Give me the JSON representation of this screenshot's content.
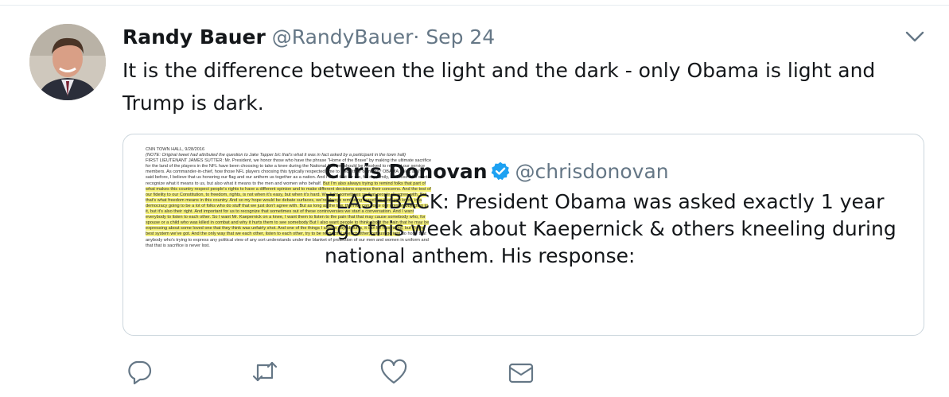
{
  "tweet": {
    "author_name": "Randy Bauer",
    "author_handle": "@RandyBauer",
    "separator": "·",
    "date": "Sep 24",
    "text": "It is the difference between the light and the dark - only Obama is light and Trump is dark."
  },
  "quoted": {
    "author_name": "Chris Donovan",
    "author_handle": "@chrisdonovan",
    "text": "FLASHBACK: President Obama was asked exactly 1 year ago this week about Kaepernick & others kneeling during national anthem. His response:",
    "image_text": {
      "header": "CNN TOWN HALL, 9/28/2016",
      "note": "(NOTE: Original tweet had attributed the question to Jake Tapper b/c that's what it was in fact asked by a participant in the town hall)",
      "plain": "FIRST LIEUTENANT JAMES SUTTER: Mr. President, we honor those who have the phrase \"Home of the Brave\" by making the ultimate sacrifice for the land of the players in the NFL have been choosing to take a knee during the National Anthem should be resolved to respect our service members. As commander-in-chief, how those NFL players choosing this typically respected time to voice their opinions? OBAMA: Well, as I've said before, I believe that us honoring our flag and our anthem us together as a nation. And I think that for me, for my family, for those who want recognize what it means to us, but also what it means to the men and women who behalf.",
      "highlighted": "But I'm also always trying to remind folks that part of what makes this country respect people's rights to have a different opinion and to make different decisions express their concerns. And the test of our fidelity to our Constitution, to freedom, rights, is not when it's easy, but when it's hard. We fight sometimes so that people disagree with. But that's what freedom means in this country. And so my hope would be debate surfaces, we're always reminding ourselves that, you know, in a democracy going to be a lot of folks who do stuff that we just don't agree with. But as long as the law, then we can voice our opinion objecting to it, but it's also their right. And important for us to recognize that sometimes out of these controversies we start a conversation. And I want everybody to listen to each other. So I want Mr. Kaepernick on a knee, I want them to listen to the pain that that may cause somebody who, for spouse or a child who was killed in combat and why it hurts them to see somebody But I also want people to think about the pain that he may be expressing about some loved one that they think was unfairly shot. And one of the things I always say about is, it can be frustrating, but it's the best system we've got. And the only way that we each other, listen to each other, try to be respectful of each other, not just go into",
      "tail": "do hope that anybody who's trying to express any political view of any sort understands under the blanket of protection of our men and women in uniform and that that is sacrifice is never lost."
    }
  },
  "icons": [
    "chevron-down-icon",
    "verified-badge-icon",
    "reply-icon",
    "retweet-icon",
    "like-icon",
    "message-icon"
  ],
  "colors": {
    "verified": "#1da1f2",
    "secondary_text": "#657786",
    "border": "#ccd6dd",
    "highlight": "#f6f27a"
  }
}
